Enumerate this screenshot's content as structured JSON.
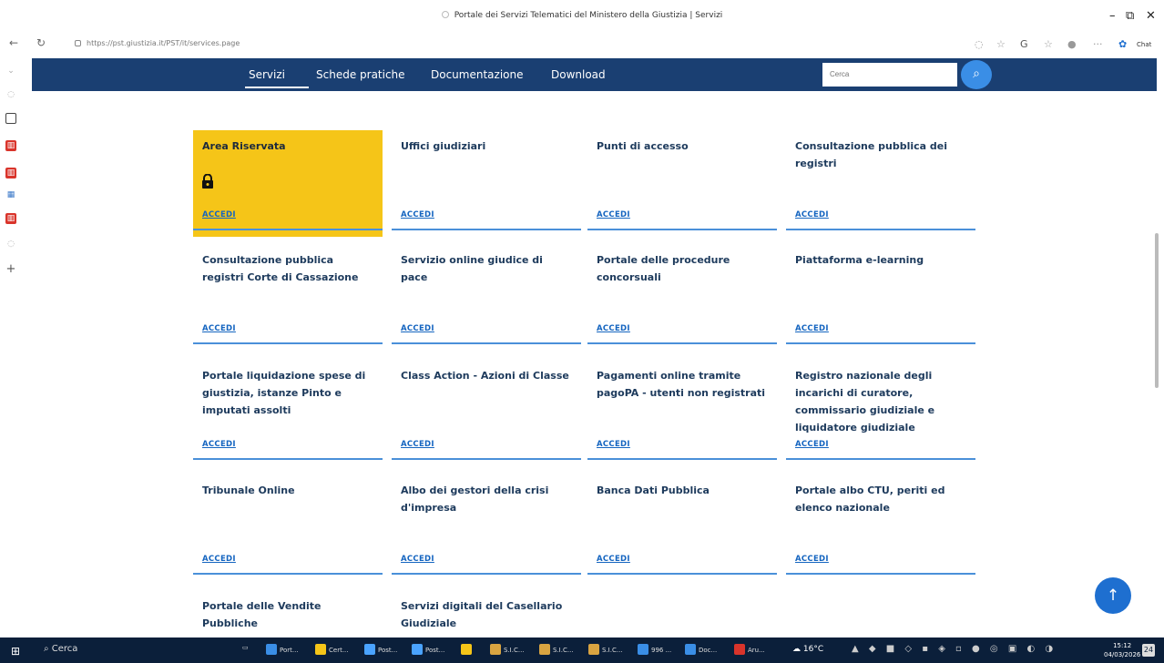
{
  "window": {
    "title": "Portale dei Servizi Telematici del Ministero della Giustizia | Servizi",
    "url": "https://pst.giustizia.it/PST/it/services.page",
    "chat_label": "Chat"
  },
  "nav": {
    "items": [
      "Servizi",
      "Schede pratiche",
      "Documentazione",
      "Download"
    ],
    "search_placeholder": "Cerca"
  },
  "tiles": [
    {
      "name": "Area Riservata",
      "link": "ACCEDI"
    },
    {
      "name": "Uffici giudiziari",
      "link": "ACCEDI"
    },
    {
      "name": "Punti di accesso",
      "link": "ACCEDI"
    },
    {
      "name": "Consultazione pubblica dei registri",
      "link": "ACCEDI"
    },
    {
      "name": "Consultazione pubblica registri Corte di Cassazione",
      "link": "ACCEDI"
    },
    {
      "name": "Servizio online giudice di pace",
      "link": "ACCEDI"
    },
    {
      "name": "Portale delle procedure concorsuali",
      "link": "ACCEDI"
    },
    {
      "name": "Piattaforma e-learning",
      "link": "ACCEDI"
    },
    {
      "name": "Portale liquidazione spese di giustizia, istanze Pinto e imputati assolti",
      "link": "ACCEDI"
    },
    {
      "name": "Class Action - Azioni di Classe",
      "link": "ACCEDI"
    },
    {
      "name": "Pagamenti online tramite pagoPA - utenti non registrati",
      "link": "ACCEDI"
    },
    {
      "name": "Registro nazionale degli incarichi di curatore, commissario giudiziale e liquidatore giudiziale",
      "link": "ACCEDI"
    },
    {
      "name": "Tribunale Online",
      "link": "ACCEDI"
    },
    {
      "name": "Albo dei gestori della crisi d'impresa",
      "link": "ACCEDI"
    },
    {
      "name": "Banca Dati Pubblica",
      "link": "ACCEDI"
    },
    {
      "name": "Portale albo CTU, periti ed elenco nazionale",
      "link": "ACCEDI"
    },
    {
      "name": "Portale delle Vendite Pubbliche",
      "link": ""
    },
    {
      "name": "Servizi digitali del Casellario Giudiziale",
      "link": ""
    }
  ],
  "taskbar": {
    "search_label": "Cerca",
    "apps": [
      "Port...",
      "Cert...",
      "Post...",
      "Post...",
      "",
      "S.I.C...",
      "S.I.C...",
      "S.I.C...",
      "996 ...",
      "Doc...",
      "Aru..."
    ],
    "weather": "16°C",
    "time": "15:12",
    "date": "04/03/2026",
    "notif_count": "24"
  },
  "colors": {
    "nav_bg": "#1a3f72",
    "accent": "#3a8ee6",
    "tile_highlight": "#f5c518",
    "link": "#1565c0",
    "divider": "#4a90d9"
  }
}
